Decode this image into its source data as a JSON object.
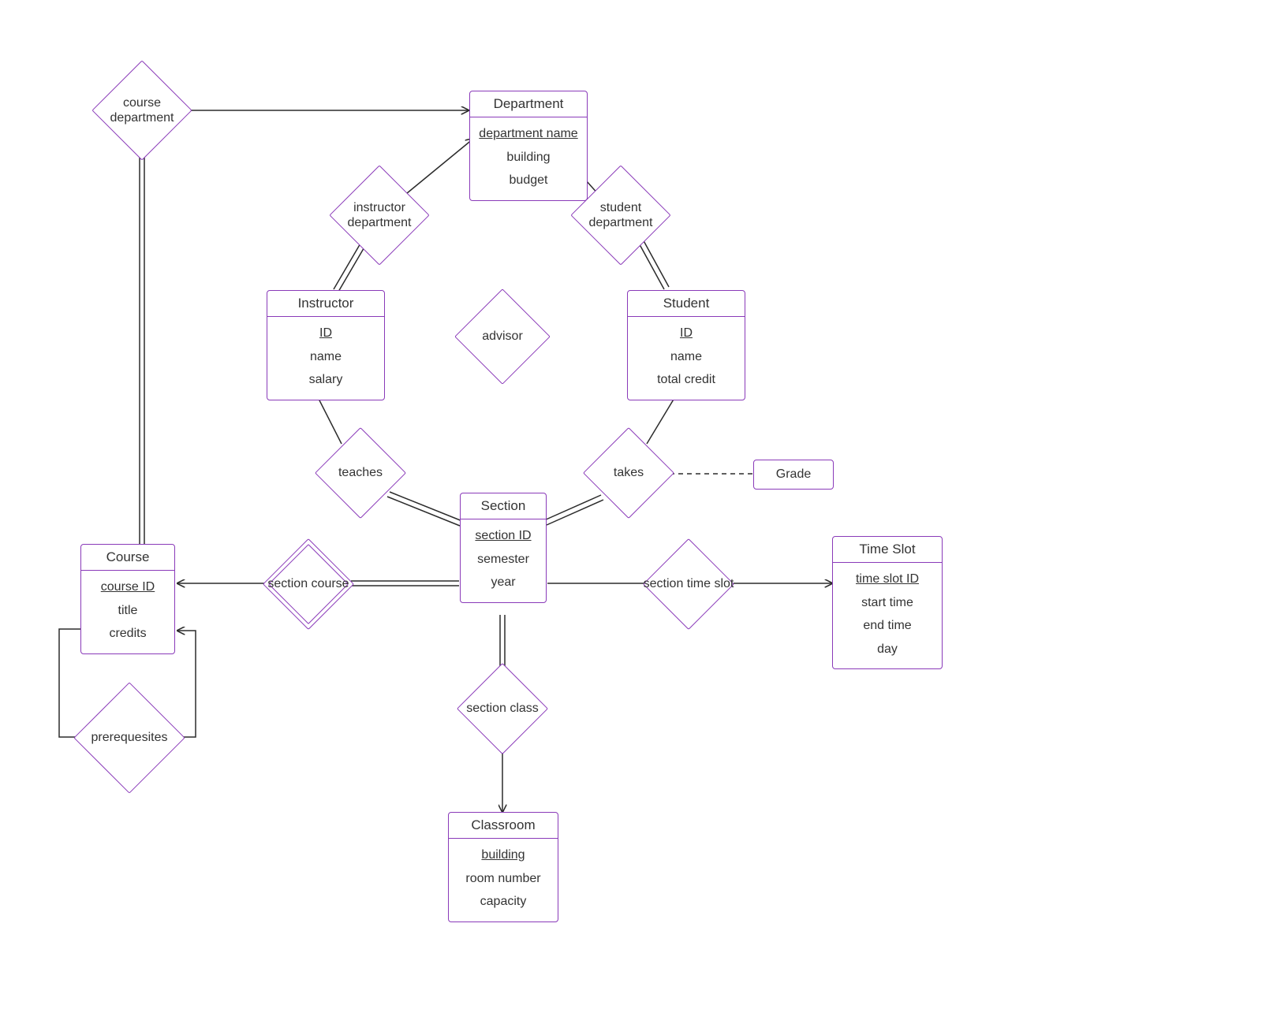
{
  "entities": {
    "department": {
      "title": "Department",
      "key": "department name",
      "attrs": [
        "building",
        "budget"
      ]
    },
    "instructor": {
      "title": "Instructor",
      "key": "ID",
      "attrs": [
        "name",
        "salary"
      ]
    },
    "student": {
      "title": "Student",
      "key": "ID",
      "attrs": [
        "name",
        "total credit"
      ]
    },
    "section": {
      "title": "Section",
      "key": "section ID",
      "attrs": [
        "semester",
        "year"
      ]
    },
    "course": {
      "title": "Course",
      "key": "course ID",
      "attrs": [
        "title",
        "credits"
      ]
    },
    "classroom": {
      "title": "Classroom",
      "key": "building",
      "attrs": [
        "room number",
        "capacity"
      ]
    },
    "timeslot": {
      "title": "Time Slot",
      "key": "time slot ID",
      "attrs": [
        "start time",
        "end time",
        "day"
      ]
    }
  },
  "relationships": {
    "course_department": "course department",
    "instructor_department": "instructor department",
    "student_department": "student department",
    "advisor": "advisor",
    "teaches": "teaches",
    "takes": "takes",
    "section_course": "section course",
    "section_class": "section class",
    "section_time_slot": "section time slot",
    "prerequisites": "prerequesites"
  },
  "misc": {
    "grade": "Grade"
  }
}
